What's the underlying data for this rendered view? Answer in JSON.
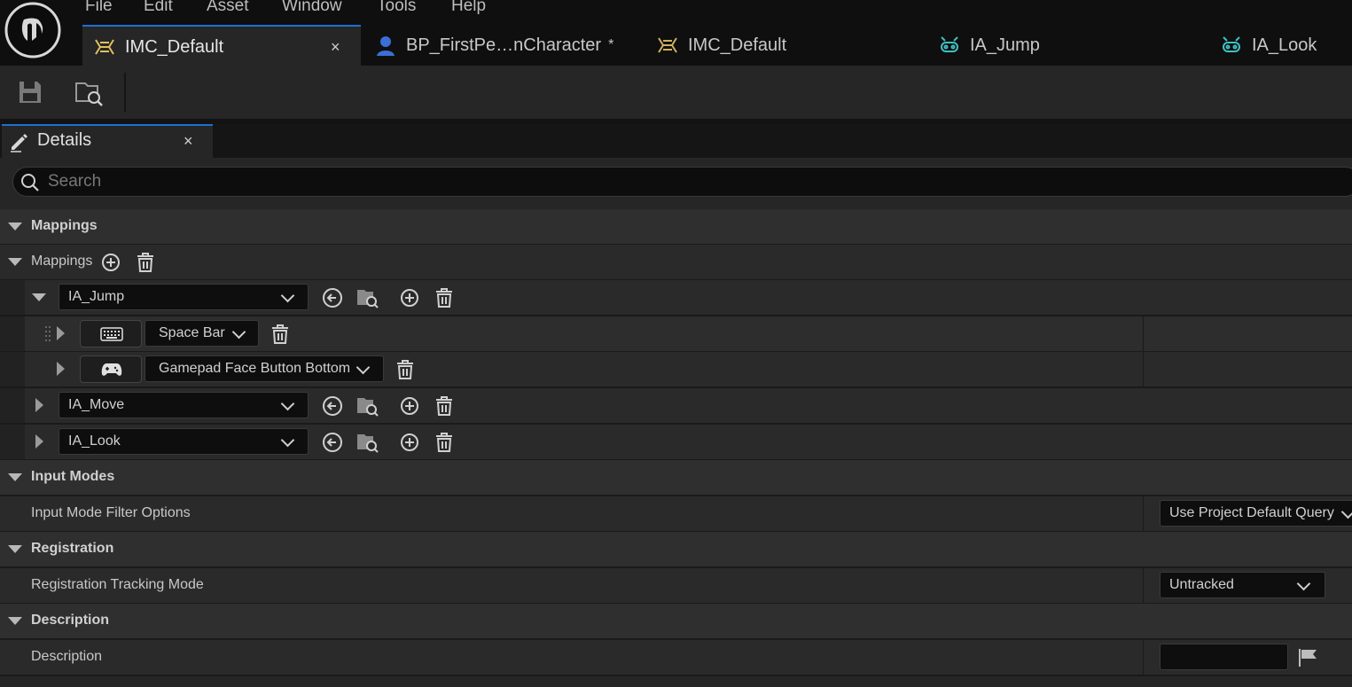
{
  "menu": {
    "file": "File",
    "edit": "Edit",
    "asset": "Asset",
    "window": "Window",
    "tools": "Tools",
    "help": "Help"
  },
  "tabs": [
    {
      "label": "IMC_Default",
      "close": "×"
    },
    {
      "label": "BP_FirstPe…nCharacter",
      "dirty": "*"
    },
    {
      "label": "IMC_Default"
    },
    {
      "label": "IA_Jump"
    },
    {
      "label": "IA_Look"
    }
  ],
  "details": {
    "title": "Details",
    "close": "×",
    "search_placeholder": "Search"
  },
  "mappings_section": {
    "label": "Mappings"
  },
  "mappings_array": {
    "label": "Mappings"
  },
  "actions": [
    {
      "name": "IA_Jump",
      "keys": [
        {
          "key": "Space Bar",
          "device": "keyboard-icon"
        },
        {
          "key": "Gamepad Face Button Bottom",
          "device": "gamepad-icon"
        }
      ]
    },
    {
      "name": "IA_Move"
    },
    {
      "name": "IA_Look"
    }
  ],
  "input_modes": {
    "label": "Input Modes",
    "filter_label": "Input Mode Filter Options",
    "filter_value": "Use Project Default Query"
  },
  "registration": {
    "label": "Registration",
    "tracking_label": "Registration Tracking Mode",
    "tracking_value": "Untracked"
  },
  "description": {
    "label": "Description",
    "field_label": "Description",
    "field_value": ""
  },
  "colors": {
    "accent": "#1e6fd0",
    "imc_icon": "#e0c060",
    "ia_icon": "#3fc0c0",
    "bp_icon": "#3a6fd8"
  }
}
